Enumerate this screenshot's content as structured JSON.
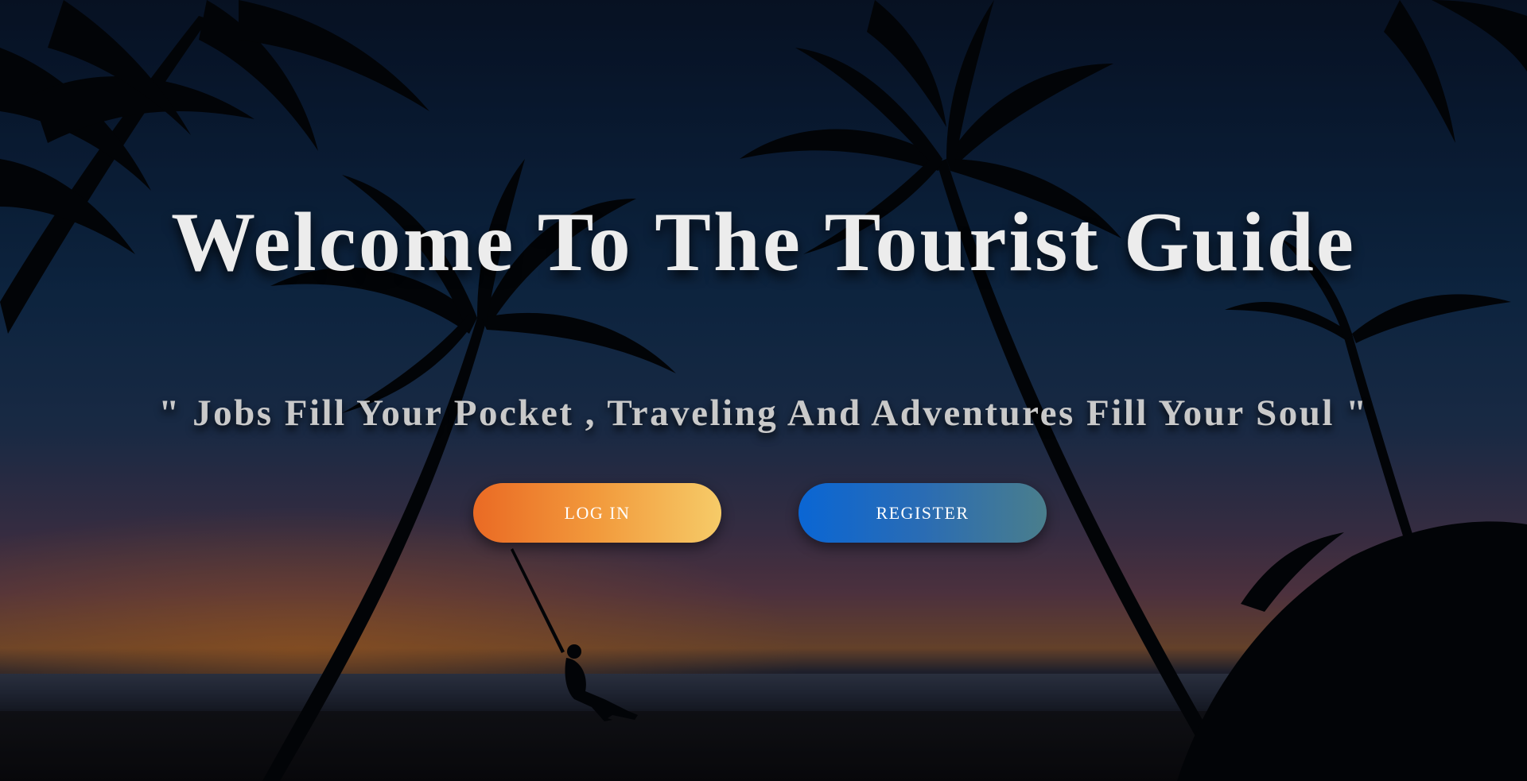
{
  "hero": {
    "title": "Welcome To The Tourist Guide",
    "subtitle": "\" Jobs Fill Your Pocket , Traveling And Adventures Fill Your Soul \""
  },
  "actions": {
    "login_label": "LOG IN",
    "register_label": "REGISTER"
  },
  "colors": {
    "login_gradient": [
      "#ea6a24",
      "#f6cb68"
    ],
    "register_gradient": [
      "#0a66d4",
      "#4a7e8c"
    ],
    "title_text": "#ececec",
    "subtitle_text": "#c9c9c9"
  },
  "background": {
    "scene": "tropical-beach-sunset-with-palm-trees-and-swing"
  }
}
